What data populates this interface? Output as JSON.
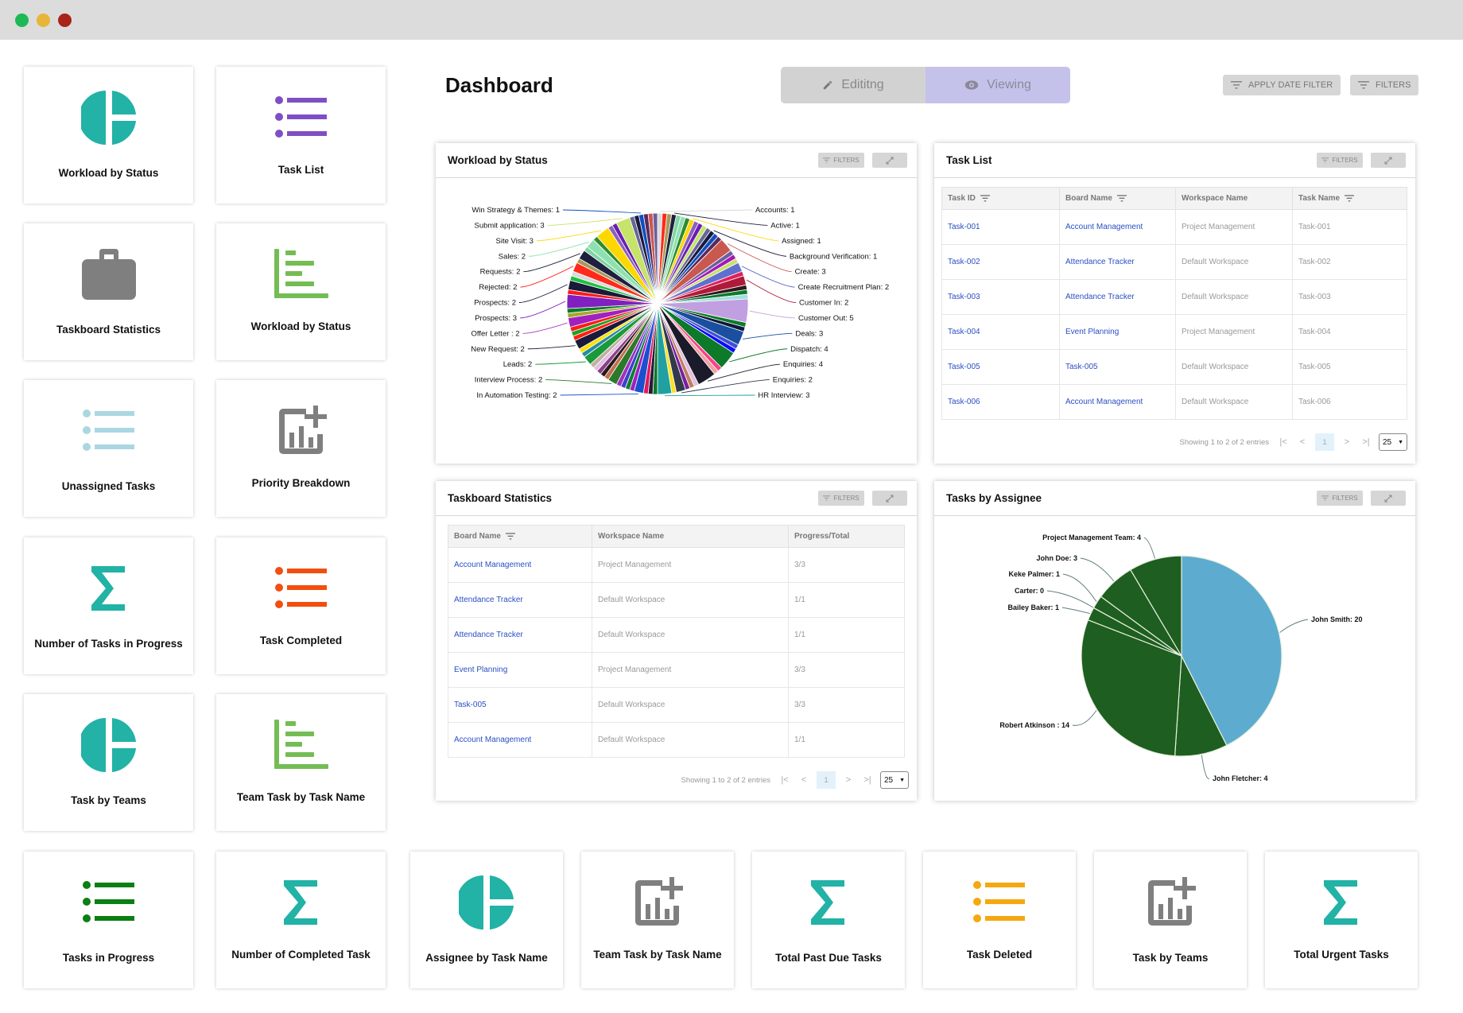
{
  "window": {
    "controls": [
      "close",
      "minimize",
      "maximize"
    ]
  },
  "page": {
    "title": "Dashboard"
  },
  "mode_toggle": {
    "editing_label": "Edititng",
    "viewing_label": "Viewing",
    "active": "Viewing"
  },
  "toolbar": {
    "apply_date_filter": "APPLY DATE FILTER",
    "filters": "FILTERS"
  },
  "widget_cards": [
    {
      "label": "Workload by Status",
      "icon": "pie-chart-icon",
      "color": "#22b2a6"
    },
    {
      "label": "Task List",
      "icon": "list-icon",
      "color": "#7e4fc4"
    },
    {
      "label": "Taskboard Statistics",
      "icon": "briefcase-icon",
      "color": "#7f7f7f"
    },
    {
      "label": "Workload by Status",
      "icon": "bar-chart-horizontal-icon",
      "color": "#74bd55"
    },
    {
      "label": "Unassigned Tasks",
      "icon": "list-icon",
      "color": "#aad7e2"
    },
    {
      "label": "Priority Breakdown",
      "icon": "add-chart-icon",
      "color": "#7f7f7f"
    },
    {
      "label": "Number of Tasks in Progress",
      "icon": "sigma-icon",
      "color": "#22b2a6"
    },
    {
      "label": "Task Completed",
      "icon": "list-icon",
      "color": "#f24e0f"
    },
    {
      "label": "Task by Teams",
      "icon": "pie-chart-icon",
      "color": "#22b2a6"
    },
    {
      "label": "Team Task by Task Name",
      "icon": "bar-chart-horizontal-icon",
      "color": "#74bd55"
    }
  ],
  "bottom_cards": [
    {
      "label": "Tasks in Progress",
      "icon": "list-icon",
      "color": "#0a7f14"
    },
    {
      "label": "Number of Completed Task",
      "icon": "sigma-icon",
      "color": "#22b2a6"
    },
    {
      "label": "Assignee by Task Name",
      "icon": "pie-chart-icon",
      "color": "#22b2a6"
    },
    {
      "label": "Team Task by Task Name",
      "icon": "add-chart-icon",
      "color": "#7f7f7f"
    },
    {
      "label": "Total Past Due Tasks",
      "icon": "sigma-icon",
      "color": "#22b2a6"
    },
    {
      "label": "Task Deleted",
      "icon": "list-icon",
      "color": "#f5a80f"
    },
    {
      "label": "Task by Teams",
      "icon": "add-chart-icon",
      "color": "#7f7f7f"
    },
    {
      "label": "Total Urgent Tasks",
      "icon": "sigma-icon",
      "color": "#22b2a6"
    }
  ],
  "panels": {
    "workload": {
      "title": "Workload by Status",
      "filters": "FILTERS"
    },
    "task_list": {
      "title": "Task List",
      "filters": "FILTERS",
      "columns": [
        "Task ID",
        "Board Name",
        "Workspace Name",
        "Task Name"
      ],
      "rows": [
        [
          "Task-001",
          "Account Management",
          "Project Management",
          "Task-001"
        ],
        [
          "Task-002",
          "Attendance Tracker",
          "Default Workspace",
          "Task-002"
        ],
        [
          "Task-003",
          "Attendance Tracker",
          "Default Workspace",
          "Task-003"
        ],
        [
          "Task-004",
          "Event Planning",
          "Project Management",
          "Task-004"
        ],
        [
          "Task-005",
          "Task-005",
          "Default Workspace",
          "Task-005"
        ],
        [
          "Task-006",
          "Account Management",
          "Default Workspace",
          "Task-006"
        ]
      ],
      "pager": {
        "summary": "Showing 1 to 2 of 2 entries",
        "page": "1",
        "page_size": "25"
      }
    },
    "taskboard": {
      "title": "Taskboard Statistics",
      "filters": "FILTERS",
      "columns": [
        "Board Name",
        "Workspace Name",
        "Progress/Total"
      ],
      "rows": [
        [
          "Account Management",
          "Project Management",
          "3/3"
        ],
        [
          "Attendance Tracker",
          "Default Workspace",
          "1/1"
        ],
        [
          "Attendance Tracker",
          "Default Workspace",
          "1/1"
        ],
        [
          "Event Planning",
          "Project Management",
          "3/3"
        ],
        [
          "Task-005",
          "Default Workspace",
          "3/3"
        ],
        [
          "Account Management",
          "Default Workspace",
          "1/1"
        ]
      ],
      "pager": {
        "summary": "Showing 1 to 2 of 2 entries",
        "page": "1",
        "page_size": "25"
      }
    },
    "assignee": {
      "title": "Tasks by Assignee",
      "filters": "FILTERS"
    }
  },
  "chart_data": [
    {
      "type": "pie",
      "title": "Workload by Status",
      "labeled_slices": [
        {
          "label": "Accounts",
          "value": 1
        },
        {
          "label": "Active",
          "value": 1
        },
        {
          "label": "Assigned",
          "value": 1
        },
        {
          "label": "Background Verification",
          "value": 1
        },
        {
          "label": "Create",
          "value": 3
        },
        {
          "label": "Create Recruitment Plan",
          "value": 2
        },
        {
          "label": "Customer In",
          "value": 2
        },
        {
          "label": "Customer Out",
          "value": 5
        },
        {
          "label": "Deals",
          "value": 3
        },
        {
          "label": "Dispatch",
          "value": 4
        },
        {
          "label": "Enquiries",
          "value": 4
        },
        {
          "label": "Enquiries",
          "value": 2
        },
        {
          "label": "HR Interview",
          "value": 3
        },
        {
          "label": "In Automation Testing",
          "value": 2
        },
        {
          "label": "Interview Process",
          "value": 2
        },
        {
          "label": "Leads",
          "value": 2
        },
        {
          "label": "New Request",
          "value": 2
        },
        {
          "label": "Offer Letter ",
          "value": 2
        },
        {
          "label": "Prospects",
          "value": 3
        },
        {
          "label": "Prospects",
          "value": 2
        },
        {
          "label": "Rejected",
          "value": 2
        },
        {
          "label": "Requests",
          "value": 2
        },
        {
          "label": "Sales",
          "value": 2
        },
        {
          "label": "Site Visit",
          "value": 3
        },
        {
          "label": "Submit application",
          "value": 3
        },
        {
          "label": "Win Strategy & Themes",
          "value": 1
        }
      ],
      "note": "Many additional small unlabeled slices are drawn",
      "palette": [
        "#d9d9d9",
        "#ff2a1a",
        "#a89a5a",
        "#1f1f3f",
        "#7fd6a3",
        "#8fe0b0",
        "#2e8b2e",
        "#ffd700",
        "#8b5fbf",
        "#6a1fb0",
        "#c6e36a",
        "#666699",
        "#1a1a40",
        "#0f4fbf",
        "#5a2a5a",
        "#c9584e",
        "#6b5fa0",
        "#a818b8",
        "#c8e070",
        "#5f6fcf",
        "#e0205a",
        "#b01a3a",
        "#2a1a1a",
        "#0d7a2a",
        "#a0e0e0",
        "#c0a0e0",
        "#0d7a2a",
        "#0d1a3a",
        "#1a4fa0",
        "#3f4fcf",
        "#0a0aff",
        "#0d7a2a",
        "#ff3f8a",
        "#f0a0a0",
        "#1a1a2a",
        "#e0c0e0",
        "#c08060",
        "#7a1fa0",
        "#303a4a",
        "#ffe020",
        "#20a0a0",
        "#0a7a2a",
        "#2a1a3a",
        "#e01a5a",
        "#1a4fcf",
        "#a020c0",
        "#0d8030",
        "#3f3fcf",
        "#a030c0",
        "#2a7a2a",
        "#c07050",
        "#2a1a1a",
        "#8a3f8a",
        "#e0c0e0",
        "#c0b0a0",
        "#1a9a3a",
        "#2a8aaa",
        "#ffe000",
        "#1a1a3a",
        "#ff2010",
        "#20a020",
        "#ff1a1a",
        "#a020c0",
        "#a8a830",
        "#0d7a2a",
        "#8020c0",
        "#ff1a1a",
        "#1a1a3a",
        "#20c040"
      ]
    },
    {
      "type": "pie",
      "title": "Tasks by Assignee",
      "slices": [
        {
          "label": "John Smith",
          "value": 20,
          "color": "#5eabd0"
        },
        {
          "label": "John Fletcher",
          "value": 4,
          "color": "#1e5e20"
        },
        {
          "label": "Robert Atkinson ",
          "value": 14,
          "color": "#1e5e20"
        },
        {
          "label": "Bailey Baker",
          "value": 1,
          "color": "#1e5e20"
        },
        {
          "label": "Carter",
          "value": 0,
          "color": "#1e5e20"
        },
        {
          "label": "Keke Palmer",
          "value": 1,
          "color": "#1e5e20"
        },
        {
          "label": "John Doe",
          "value": 3,
          "color": "#1e5e20"
        },
        {
          "label": "Project Management Team",
          "value": 4,
          "color": "#1e5e20"
        }
      ]
    }
  ]
}
